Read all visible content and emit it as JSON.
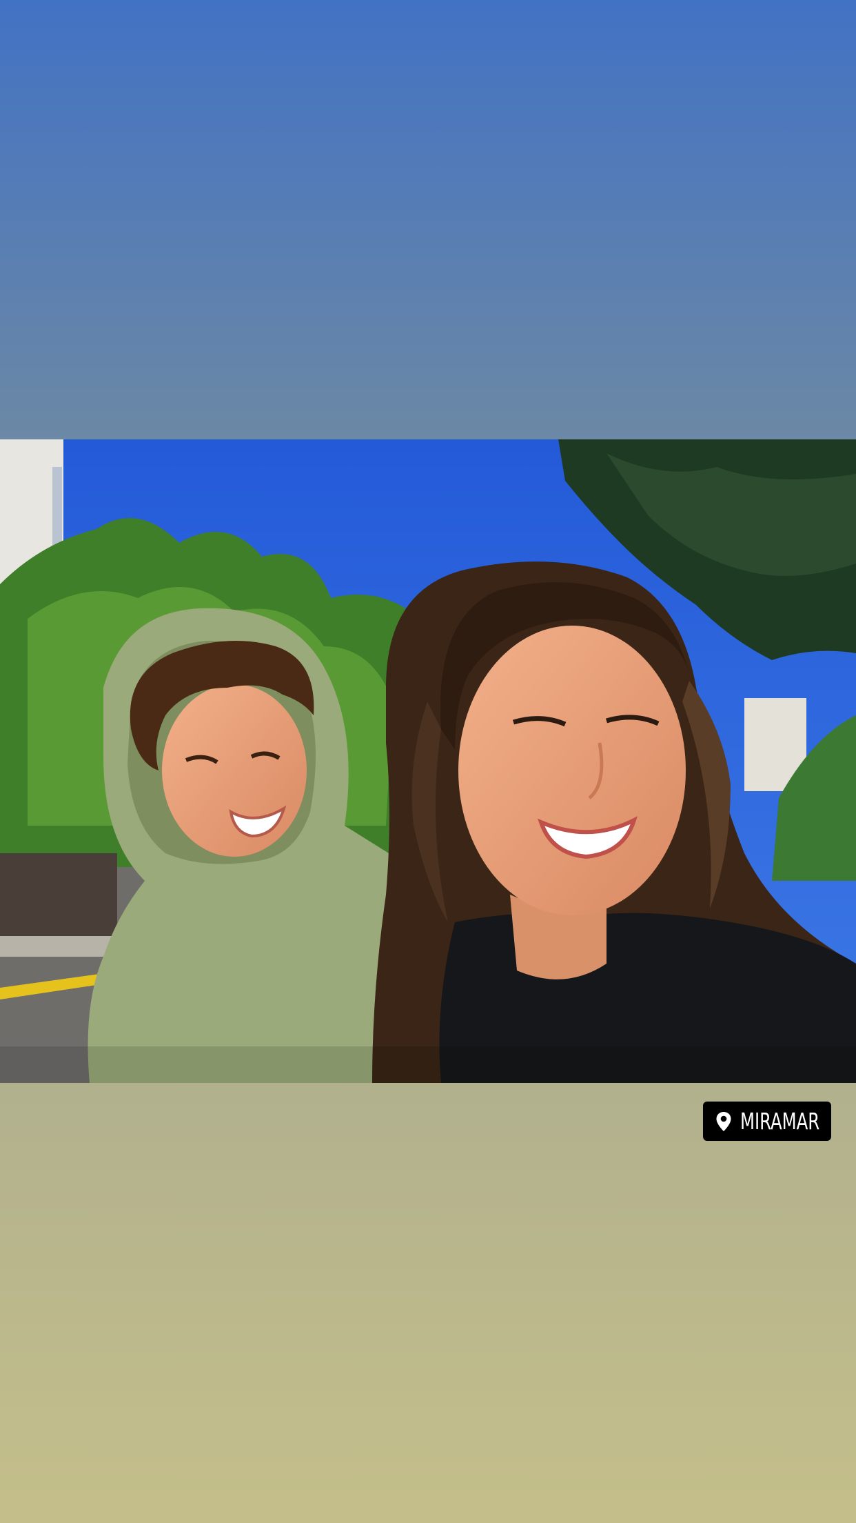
{
  "story": {
    "background_gradient": [
      "#4272c4",
      "#6a88a6",
      "#9aa894",
      "#c4bf8a"
    ],
    "photo": {
      "icon": "selfie-photo",
      "sky_color": "#2f66e0"
    },
    "location_sticker": {
      "icon": "location-pin-icon",
      "label": "MIRAMAR",
      "background": "#000000",
      "text_color": "#ffffff"
    }
  }
}
